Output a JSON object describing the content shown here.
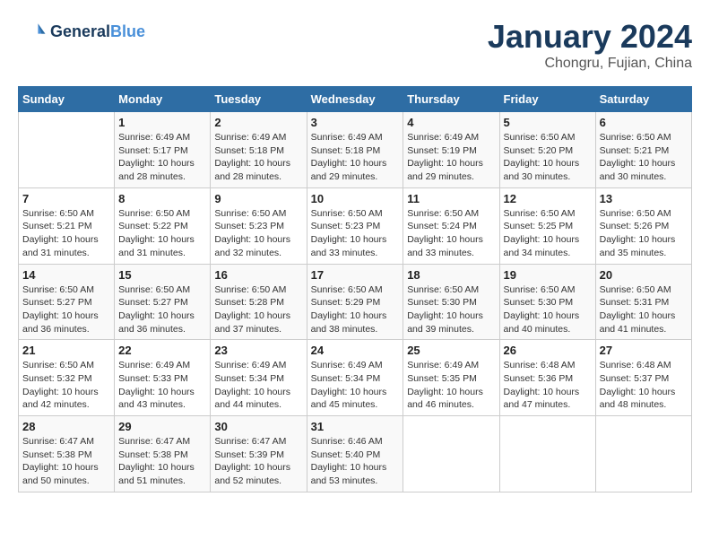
{
  "header": {
    "logo_line1": "General",
    "logo_line2": "Blue",
    "month": "January 2024",
    "location": "Chongru, Fujian, China"
  },
  "days_of_week": [
    "Sunday",
    "Monday",
    "Tuesday",
    "Wednesday",
    "Thursday",
    "Friday",
    "Saturday"
  ],
  "weeks": [
    [
      {
        "day": "",
        "info": ""
      },
      {
        "day": "1",
        "info": "Sunrise: 6:49 AM\nSunset: 5:17 PM\nDaylight: 10 hours\nand 28 minutes."
      },
      {
        "day": "2",
        "info": "Sunrise: 6:49 AM\nSunset: 5:18 PM\nDaylight: 10 hours\nand 28 minutes."
      },
      {
        "day": "3",
        "info": "Sunrise: 6:49 AM\nSunset: 5:18 PM\nDaylight: 10 hours\nand 29 minutes."
      },
      {
        "day": "4",
        "info": "Sunrise: 6:49 AM\nSunset: 5:19 PM\nDaylight: 10 hours\nand 29 minutes."
      },
      {
        "day": "5",
        "info": "Sunrise: 6:50 AM\nSunset: 5:20 PM\nDaylight: 10 hours\nand 30 minutes."
      },
      {
        "day": "6",
        "info": "Sunrise: 6:50 AM\nSunset: 5:21 PM\nDaylight: 10 hours\nand 30 minutes."
      }
    ],
    [
      {
        "day": "7",
        "info": "Sunrise: 6:50 AM\nSunset: 5:21 PM\nDaylight: 10 hours\nand 31 minutes."
      },
      {
        "day": "8",
        "info": "Sunrise: 6:50 AM\nSunset: 5:22 PM\nDaylight: 10 hours\nand 31 minutes."
      },
      {
        "day": "9",
        "info": "Sunrise: 6:50 AM\nSunset: 5:23 PM\nDaylight: 10 hours\nand 32 minutes."
      },
      {
        "day": "10",
        "info": "Sunrise: 6:50 AM\nSunset: 5:23 PM\nDaylight: 10 hours\nand 33 minutes."
      },
      {
        "day": "11",
        "info": "Sunrise: 6:50 AM\nSunset: 5:24 PM\nDaylight: 10 hours\nand 33 minutes."
      },
      {
        "day": "12",
        "info": "Sunrise: 6:50 AM\nSunset: 5:25 PM\nDaylight: 10 hours\nand 34 minutes."
      },
      {
        "day": "13",
        "info": "Sunrise: 6:50 AM\nSunset: 5:26 PM\nDaylight: 10 hours\nand 35 minutes."
      }
    ],
    [
      {
        "day": "14",
        "info": "Sunrise: 6:50 AM\nSunset: 5:27 PM\nDaylight: 10 hours\nand 36 minutes."
      },
      {
        "day": "15",
        "info": "Sunrise: 6:50 AM\nSunset: 5:27 PM\nDaylight: 10 hours\nand 36 minutes."
      },
      {
        "day": "16",
        "info": "Sunrise: 6:50 AM\nSunset: 5:28 PM\nDaylight: 10 hours\nand 37 minutes."
      },
      {
        "day": "17",
        "info": "Sunrise: 6:50 AM\nSunset: 5:29 PM\nDaylight: 10 hours\nand 38 minutes."
      },
      {
        "day": "18",
        "info": "Sunrise: 6:50 AM\nSunset: 5:30 PM\nDaylight: 10 hours\nand 39 minutes."
      },
      {
        "day": "19",
        "info": "Sunrise: 6:50 AM\nSunset: 5:30 PM\nDaylight: 10 hours\nand 40 minutes."
      },
      {
        "day": "20",
        "info": "Sunrise: 6:50 AM\nSunset: 5:31 PM\nDaylight: 10 hours\nand 41 minutes."
      }
    ],
    [
      {
        "day": "21",
        "info": "Sunrise: 6:50 AM\nSunset: 5:32 PM\nDaylight: 10 hours\nand 42 minutes."
      },
      {
        "day": "22",
        "info": "Sunrise: 6:49 AM\nSunset: 5:33 PM\nDaylight: 10 hours\nand 43 minutes."
      },
      {
        "day": "23",
        "info": "Sunrise: 6:49 AM\nSunset: 5:34 PM\nDaylight: 10 hours\nand 44 minutes."
      },
      {
        "day": "24",
        "info": "Sunrise: 6:49 AM\nSunset: 5:34 PM\nDaylight: 10 hours\nand 45 minutes."
      },
      {
        "day": "25",
        "info": "Sunrise: 6:49 AM\nSunset: 5:35 PM\nDaylight: 10 hours\nand 46 minutes."
      },
      {
        "day": "26",
        "info": "Sunrise: 6:48 AM\nSunset: 5:36 PM\nDaylight: 10 hours\nand 47 minutes."
      },
      {
        "day": "27",
        "info": "Sunrise: 6:48 AM\nSunset: 5:37 PM\nDaylight: 10 hours\nand 48 minutes."
      }
    ],
    [
      {
        "day": "28",
        "info": "Sunrise: 6:47 AM\nSunset: 5:38 PM\nDaylight: 10 hours\nand 50 minutes."
      },
      {
        "day": "29",
        "info": "Sunrise: 6:47 AM\nSunset: 5:38 PM\nDaylight: 10 hours\nand 51 minutes."
      },
      {
        "day": "30",
        "info": "Sunrise: 6:47 AM\nSunset: 5:39 PM\nDaylight: 10 hours\nand 52 minutes."
      },
      {
        "day": "31",
        "info": "Sunrise: 6:46 AM\nSunset: 5:40 PM\nDaylight: 10 hours\nand 53 minutes."
      },
      {
        "day": "",
        "info": ""
      },
      {
        "day": "",
        "info": ""
      },
      {
        "day": "",
        "info": ""
      }
    ]
  ]
}
